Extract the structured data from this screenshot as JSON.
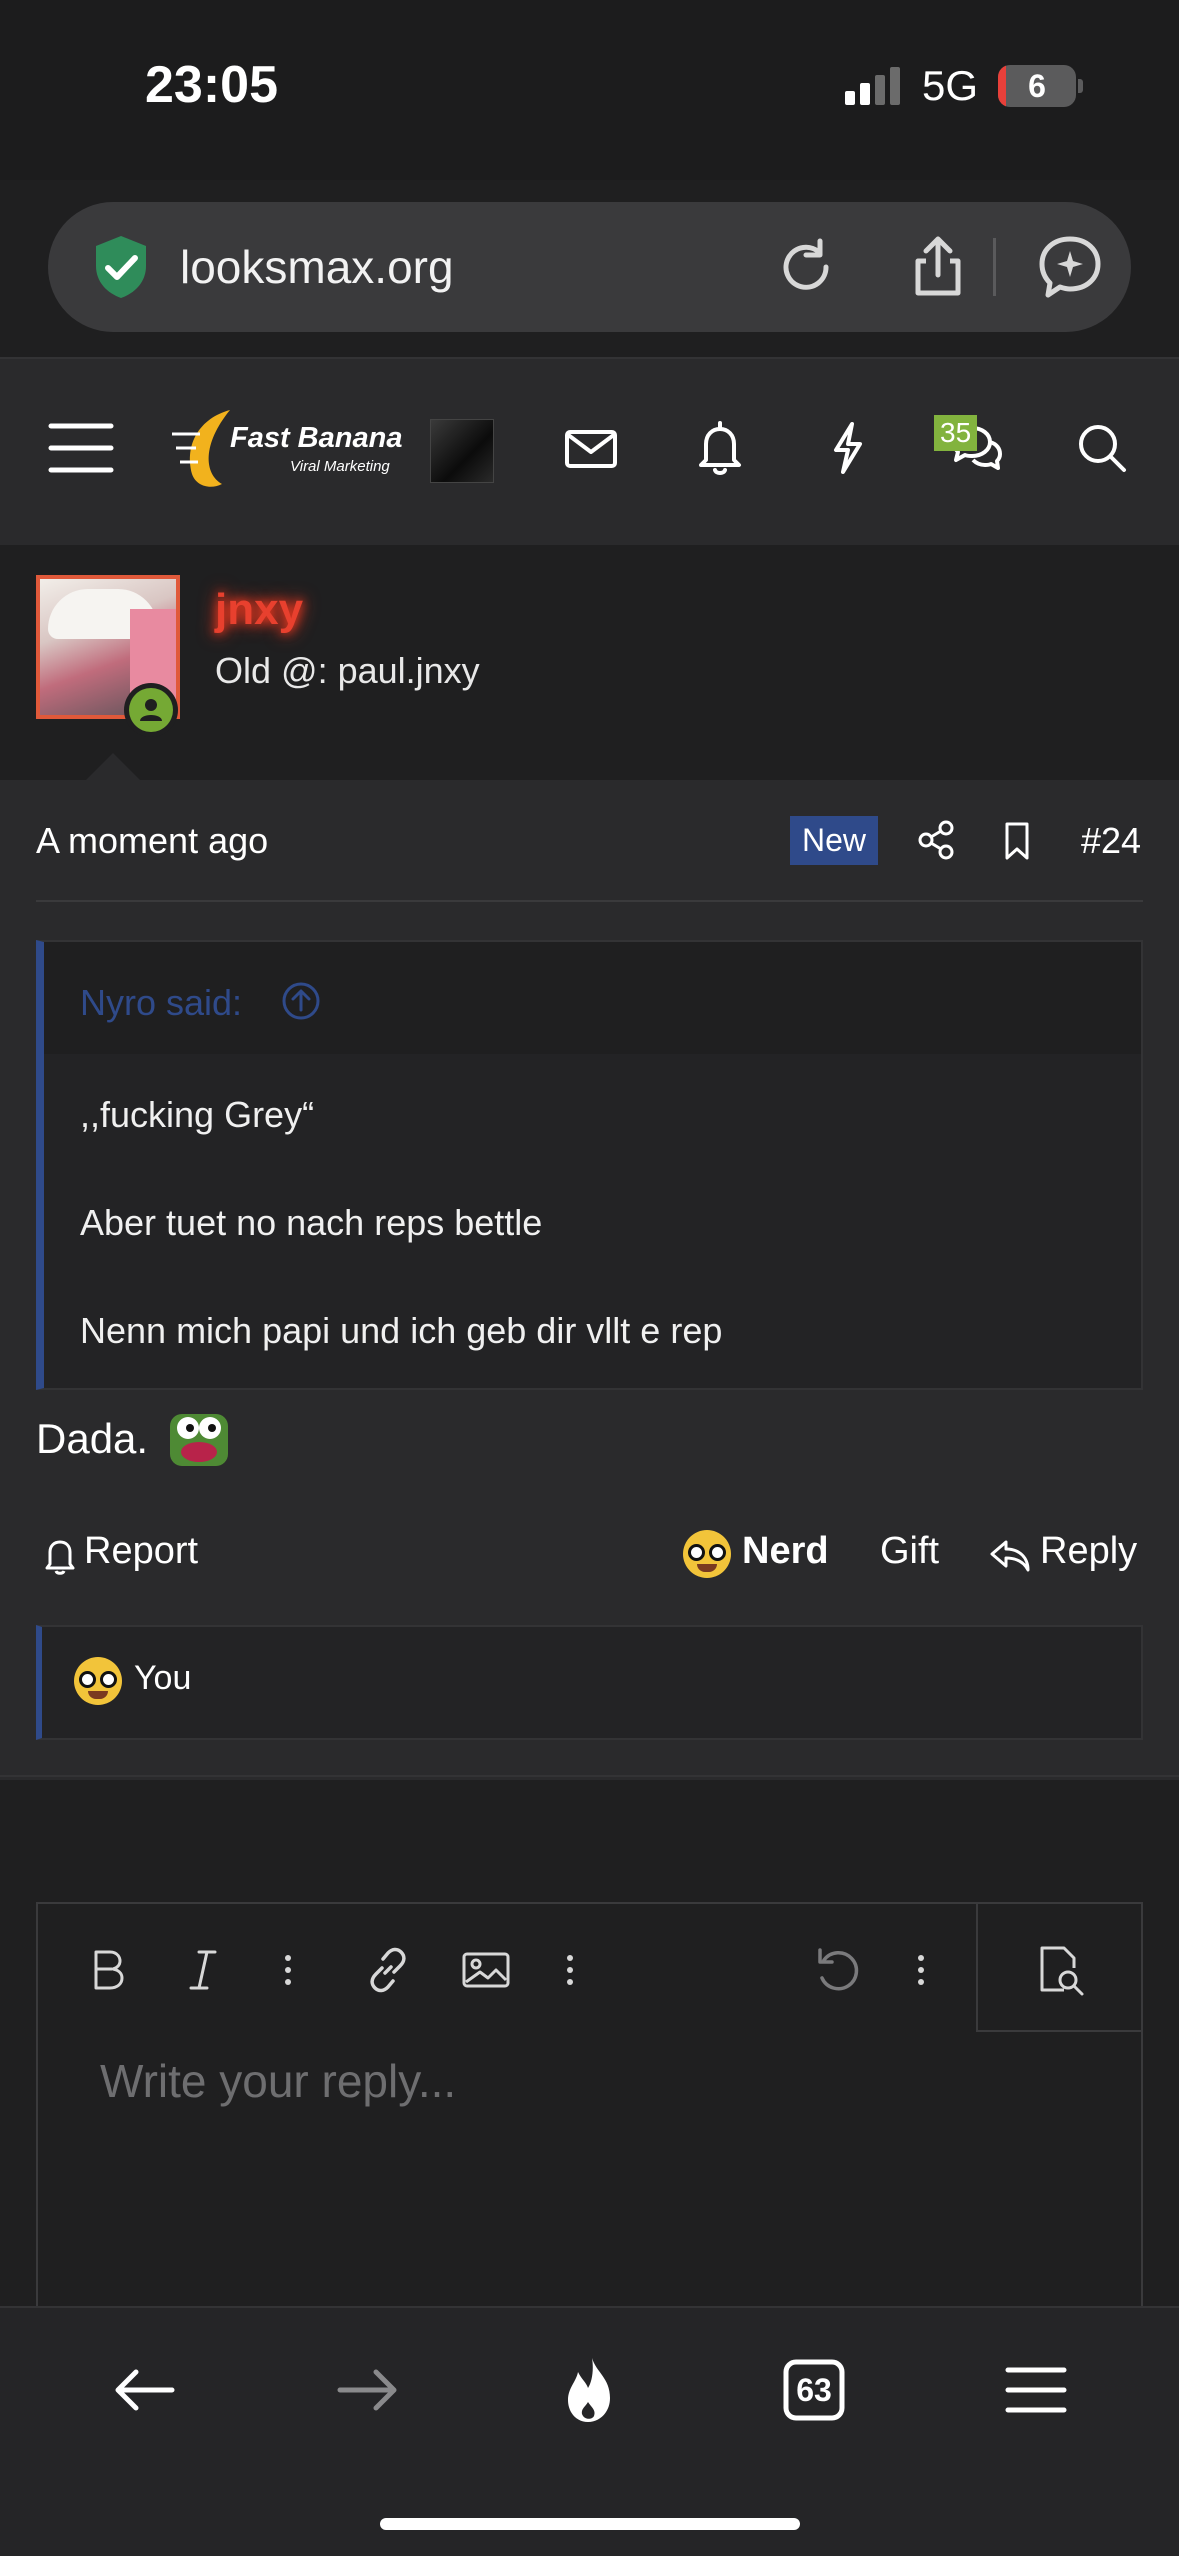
{
  "status_bar": {
    "time": "23:05",
    "network": "5G",
    "battery": "6"
  },
  "browser": {
    "url": "looksmax.org"
  },
  "forum_nav": {
    "logo_line1": "Fast Banana",
    "logo_line2": "Viral Marketing",
    "chat_badge": "35"
  },
  "post": {
    "username": "jnxy",
    "user_title": "Old @: paul.jnxy",
    "time": "A moment ago",
    "new_label": "New",
    "number": "#24",
    "quote": {
      "author": "Nyro said:",
      "lines": [
        ",,fucking Grey“",
        "Aber tuet no nach reps bettle",
        "Nenn mich papi und ich geb dir vllt e rep"
      ]
    },
    "text": "Dada.",
    "actions": {
      "report": "Report",
      "nerd": "Nerd",
      "gift": "Gift",
      "reply": "Reply"
    },
    "reaction_user": "You"
  },
  "editor": {
    "placeholder": "Write your reply..."
  },
  "bottom_bar": {
    "tabs_count": "63"
  },
  "colors": {
    "accent": "#2f4a8a",
    "username": "#e8402e",
    "badge": "#82b33e"
  }
}
